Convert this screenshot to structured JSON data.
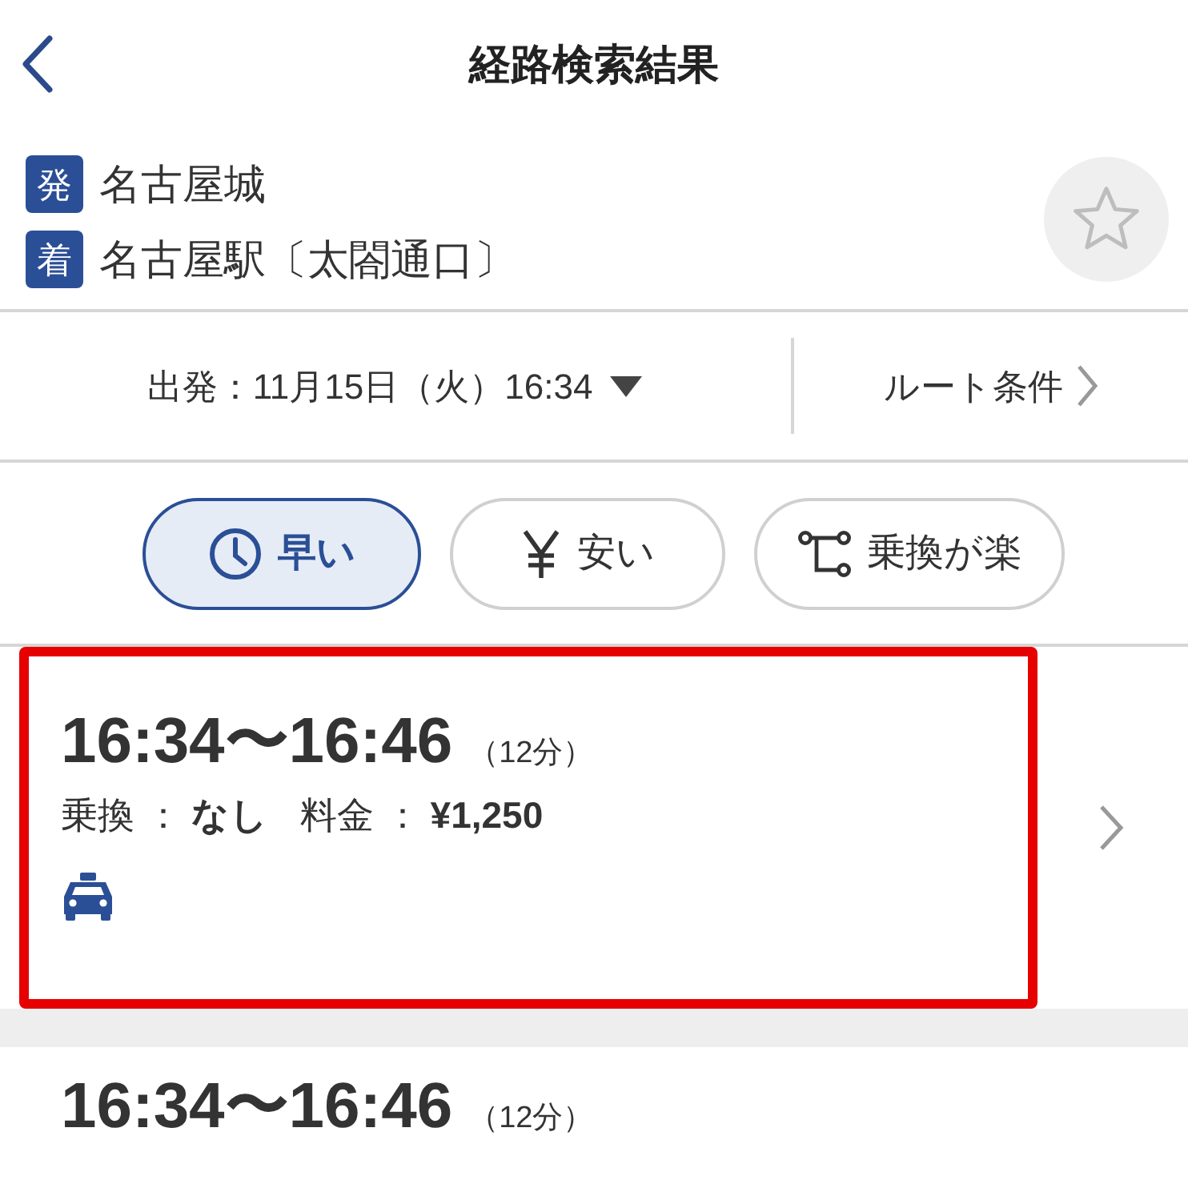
{
  "header": {
    "title": "経路検索結果"
  },
  "stations": [
    {
      "badge": "発",
      "name": "名古屋城"
    },
    {
      "badge": "着",
      "name": "名古屋駅〔太閤通口〕"
    }
  ],
  "departure": {
    "label": "出発：11月15日（火）16:34"
  },
  "route_conditions": {
    "label": "ルート条件"
  },
  "sort_tabs": [
    {
      "kind": "clock",
      "label": "早い",
      "selected": true
    },
    {
      "kind": "yen",
      "label": "安い",
      "selected": false
    },
    {
      "kind": "transfer",
      "label": "乗換が楽",
      "selected": false
    }
  ],
  "routes": [
    {
      "time": "16:34〜16:46",
      "duration": "（12分）",
      "transfer_label": "乗換 ：",
      "transfer": "なし",
      "fare_label": "料金 ：",
      "fare": "¥1,250",
      "transport": {
        "kind": "taxi"
      },
      "highlighted": true
    },
    {
      "time": "16:34〜16:46",
      "duration": "（12分）",
      "highlighted": false
    }
  ]
}
